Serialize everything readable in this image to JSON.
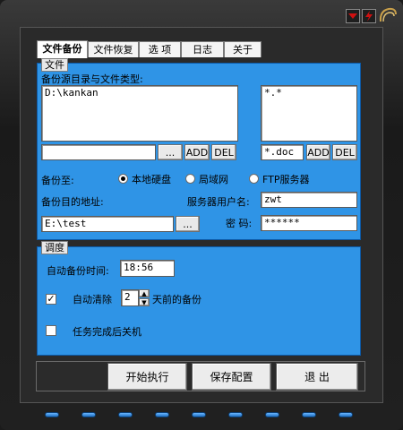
{
  "tabs": [
    "文件备份",
    "文件恢复",
    "选 项",
    "日志",
    "关于"
  ],
  "file_group": {
    "legend": "文件",
    "source_label": "备份源目录与文件类型:",
    "source_dirs": [
      "D:\\kankan"
    ],
    "file_types": [
      "*.*"
    ],
    "dir_input_value": "",
    "browse_label": "...",
    "add_label": "ADD",
    "del_label": "DEL",
    "type_input_value": "*.doc",
    "type_add_label": "ADD",
    "type_del_label": "DEL",
    "backup_to_label": "备份至:",
    "radio_local": "本地硬盘",
    "radio_lan": "局域网",
    "radio_ftp": "FTP服务器",
    "selected_target": "本地硬盘",
    "dest_label": "备份目的地址:",
    "dest_value": "E:\\test",
    "dest_browse_label": "...",
    "server_user_label": "服务器用户名:",
    "server_user_value": "zwt",
    "password_label": "密  码:",
    "password_value": "******"
  },
  "schedule_group": {
    "legend": "调度",
    "auto_time_label": "自动备份时间:",
    "auto_time_value": "18:56",
    "auto_clean_checked": true,
    "auto_clean_label": "自动清除",
    "days_value": "2",
    "days_suffix_label": "天前的备份",
    "shutdown_checked": false,
    "shutdown_label": "任务完成后关机"
  },
  "actions": {
    "start_label": "开始执行",
    "save_label": "保存配置",
    "exit_label": "退  出"
  },
  "colors": {
    "panel": "#2f94e6",
    "frame": "#1b1b1b",
    "accent_red": "#d01010"
  }
}
